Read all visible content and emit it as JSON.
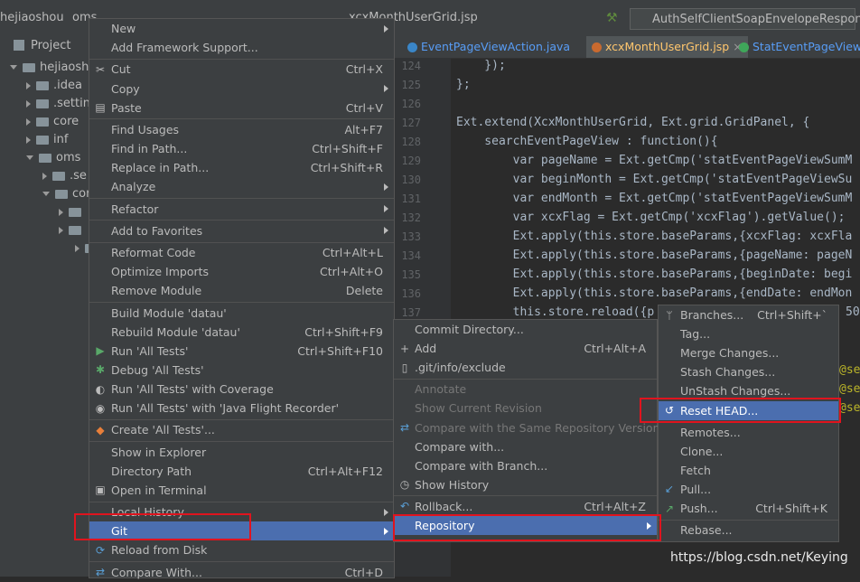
{
  "breadcrumb": {
    "project": "hejiaoshou",
    "module": "oms",
    "file": "xcxMonthUserGrid.jsp",
    "run_config": "AuthSelfClientSoapEnvelopeResponse"
  },
  "project_panel": {
    "title": "Project",
    "tree": [
      {
        "label": "hejiaoshou",
        "depth": 0,
        "expanded": true
      },
      {
        "label": ".idea",
        "depth": 1
      },
      {
        "label": ".settin",
        "depth": 1
      },
      {
        "label": "core",
        "depth": 1
      },
      {
        "label": "inf",
        "depth": 1
      },
      {
        "label": "oms",
        "depth": 1,
        "expanded": true
      },
      {
        "label": ".se",
        "depth": 2
      },
      {
        "label": "cor",
        "depth": 2,
        "expanded": true
      },
      {
        "label": "",
        "depth": 3
      },
      {
        "label": "",
        "depth": 3
      },
      {
        "label": "",
        "depth": 4
      }
    ]
  },
  "editor": {
    "tabs": [
      {
        "label": "EventPageViewAction.java",
        "active": false
      },
      {
        "label": "xcxMonthUserGrid.jsp",
        "active": true
      },
      {
        "label": "StatEventPageView",
        "active": false
      }
    ],
    "line_numbers": [
      "124",
      "125",
      "126",
      "127",
      "128",
      "129",
      "130",
      "131",
      "132",
      "133",
      "134",
      "135",
      "136",
      "137"
    ],
    "code_lines": [
      "    });",
      "};",
      "",
      "Ext.extend(XcxMonthUserGrid, Ext.grid.GridPanel, {",
      "    searchEventPageView : function(){",
      "        var pageName = Ext.getCmp('statEventPageViewSumM",
      "        var beginMonth = Ext.getCmp('statEventPageViewSu",
      "        var endMonth = Ext.getCmp('statEventPageViewSumM",
      "        var xcxFlag = Ext.getCmp('xcxFlag').getValue();",
      "        Ext.apply(this.store.baseParams,{xcxFlag: xcxFla",
      "        Ext.apply(this.store.baseParams,{pageName: pageN",
      "        Ext.apply(this.store.baseParams,{beginDate: begi",
      "        Ext.apply(this.store.baseParams,{endDate: endMon",
      "        this.store.reload({p"
    ],
    "code_fragment_right": "50",
    "annotation_fragments": [
      "@se",
      "@se",
      "@se"
    ]
  },
  "context_menu": [
    {
      "label": "New",
      "submenu": true
    },
    {
      "label": "Add Framework Support..."
    },
    {
      "sep": true
    },
    {
      "label": "Cut",
      "shortcut": "Ctrl+X",
      "icon": "scissors-icon"
    },
    {
      "label": "Copy",
      "submenu": true
    },
    {
      "label": "Paste",
      "shortcut": "Ctrl+V",
      "icon": "clipboard-icon"
    },
    {
      "sep": true
    },
    {
      "label": "Find Usages",
      "shortcut": "Alt+F7"
    },
    {
      "label": "Find in Path...",
      "shortcut": "Ctrl+Shift+F"
    },
    {
      "label": "Replace in Path...",
      "shortcut": "Ctrl+Shift+R"
    },
    {
      "label": "Analyze",
      "submenu": true
    },
    {
      "sep": true
    },
    {
      "label": "Refactor",
      "submenu": true
    },
    {
      "sep": true
    },
    {
      "label": "Add to Favorites",
      "submenu": true
    },
    {
      "sep": true
    },
    {
      "label": "Reformat Code",
      "shortcut": "Ctrl+Alt+L"
    },
    {
      "label": "Optimize Imports",
      "shortcut": "Ctrl+Alt+O"
    },
    {
      "label": "Remove Module",
      "shortcut": "Delete"
    },
    {
      "sep": true
    },
    {
      "label": "Build Module 'datau'"
    },
    {
      "label": "Rebuild Module 'datau'",
      "shortcut": "Ctrl+Shift+F9"
    },
    {
      "label": "Run 'All Tests'",
      "shortcut": "Ctrl+Shift+F10",
      "icon": "run-icon"
    },
    {
      "label": "Debug 'All Tests'",
      "icon": "debug-icon"
    },
    {
      "label": "Run 'All Tests' with Coverage",
      "icon": "coverage-icon"
    },
    {
      "label": "Run 'All Tests' with 'Java Flight Recorder'",
      "icon": "profiler-icon"
    },
    {
      "sep": true
    },
    {
      "label": "Create 'All Tests'...",
      "icon": "create-test-icon"
    },
    {
      "sep": true
    },
    {
      "label": "Show in Explorer"
    },
    {
      "label": "Directory Path",
      "shortcut": "Ctrl+Alt+F12"
    },
    {
      "label": "Open in Terminal",
      "icon": "terminal-icon"
    },
    {
      "sep": true
    },
    {
      "label": "Local History",
      "submenu": true
    },
    {
      "label": "Git",
      "submenu": true,
      "selected": true
    },
    {
      "label": "Reload from Disk",
      "icon": "reload-icon"
    },
    {
      "sep": true
    },
    {
      "label": "Compare With...",
      "shortcut": "Ctrl+D",
      "icon": "compare-icon"
    }
  ],
  "git_menu": [
    {
      "label": "Commit Directory..."
    },
    {
      "label": "Add",
      "shortcut": "Ctrl+Alt+A",
      "icon": "plus-icon"
    },
    {
      "label": ".git/info/exclude",
      "icon": "file-icon"
    },
    {
      "sep": true
    },
    {
      "label": "Annotate",
      "disabled": true
    },
    {
      "label": "Show Current Revision",
      "disabled": true
    },
    {
      "label": "Compare with the Same Repository Version",
      "disabled": true,
      "icon": "compare-icon"
    },
    {
      "label": "Compare with..."
    },
    {
      "label": "Compare with Branch..."
    },
    {
      "label": "Show History",
      "icon": "history-icon"
    },
    {
      "sep": true
    },
    {
      "label": "Rollback...",
      "shortcut": "Ctrl+Alt+Z",
      "icon": "rollback-icon"
    },
    {
      "label": "Repository",
      "submenu": true,
      "selected": true
    }
  ],
  "repo_menu": [
    {
      "label": "Branches...",
      "shortcut": "Ctrl+Shift+`",
      "icon": "branch-icon"
    },
    {
      "label": "Tag..."
    },
    {
      "label": "Merge Changes..."
    },
    {
      "label": "Stash Changes..."
    },
    {
      "label": "UnStash Changes..."
    },
    {
      "label": "Reset HEAD...",
      "selected": true,
      "icon": "reset-icon"
    },
    {
      "sep": true
    },
    {
      "label": "Remotes..."
    },
    {
      "label": "Clone..."
    },
    {
      "label": "Fetch"
    },
    {
      "label": "Pull...",
      "icon": "pull-icon"
    },
    {
      "label": "Push...",
      "shortcut": "Ctrl+Shift+K",
      "icon": "push-icon"
    },
    {
      "sep": true
    },
    {
      "label": "Rebase..."
    }
  ],
  "watermark": "https://blog.csdn.net/Keying",
  "colors": {
    "menu_bg": "#3c3f41",
    "selection": "#4b6eaf",
    "highlight_box": "#e0141e",
    "editor_bg": "#2b2b2b"
  }
}
